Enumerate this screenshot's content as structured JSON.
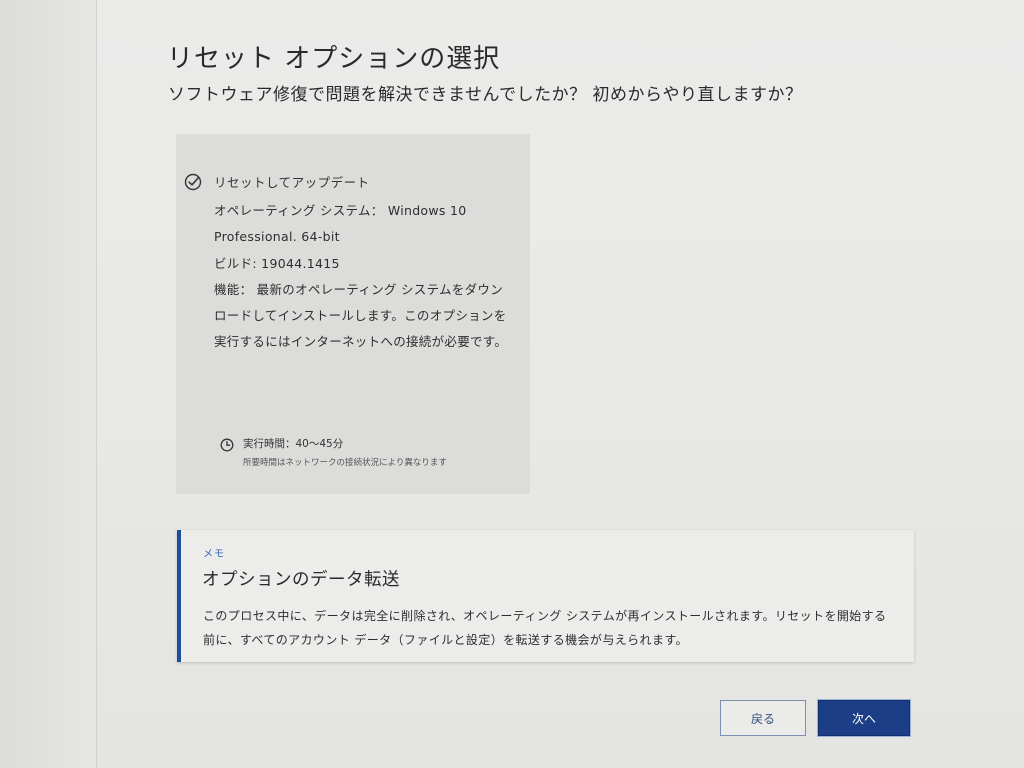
{
  "header": {
    "title": "リセット オプションの選択",
    "subtitle": "ソフトウェア修復で問題を解決できませんでしたか？ 初めからやり直しますか？"
  },
  "option_card": {
    "title": "リセットしてアップデート",
    "os_line": "オペレーティング システム： Windows 10 Professional. 64-bit",
    "build_line": "ビルド: 19044.1415",
    "feature_line": "機能： 最新のオペレーティング システムをダウンロードしてインストールします。このオプションを実行するにはインターネットへの接続が必要です。",
    "time_label": "実行時間：40～45分",
    "time_note": "所要時間はネットワークの接続状況により異なります",
    "icons": {
      "check": "check-circle-icon",
      "clock": "clock-icon"
    }
  },
  "memo": {
    "label": "メモ",
    "title": "オプションのデータ転送",
    "text": "このプロセス中に、データは完全に削除され、オペレーティング システムが再インストールされます。リセットを開始する前に、すべてのアカウント データ（ファイルと設定）を転送する機会が与えられます。"
  },
  "buttons": {
    "back_label": "戻る",
    "next_label": "次へ"
  },
  "colors": {
    "accent": "#1b3e86",
    "memo_border": "#1e4f9e"
  }
}
